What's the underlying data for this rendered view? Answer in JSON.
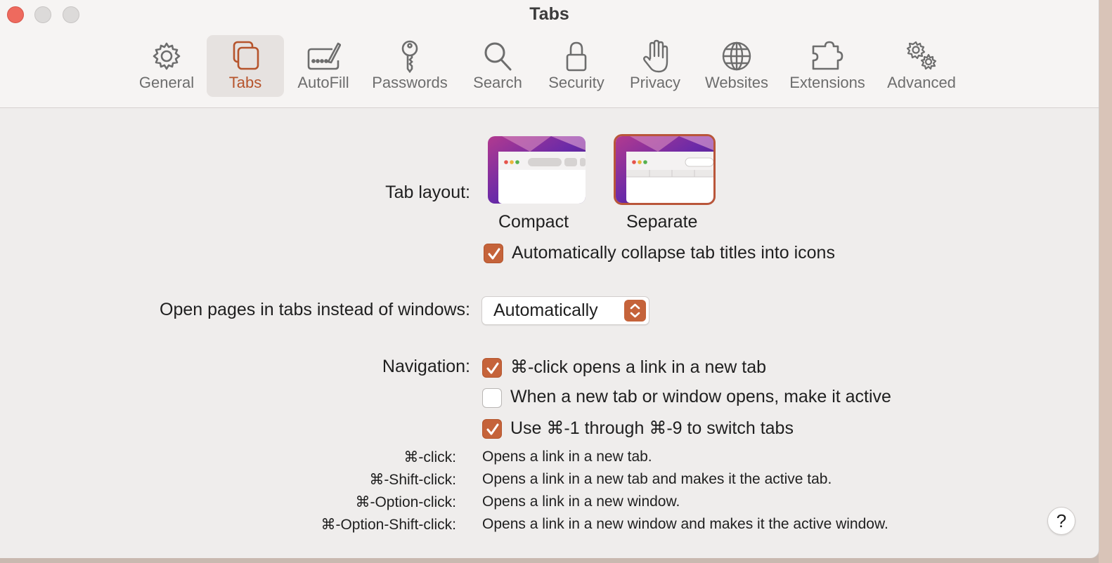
{
  "window": {
    "title": "Tabs"
  },
  "toolbar": {
    "tabs": [
      {
        "label": "General",
        "icon": "gear-icon"
      },
      {
        "label": "Tabs",
        "icon": "tabs-icon",
        "selected": true
      },
      {
        "label": "AutoFill",
        "icon": "autofill-icon"
      },
      {
        "label": "Passwords",
        "icon": "key-icon"
      },
      {
        "label": "Search",
        "icon": "magnifier-icon"
      },
      {
        "label": "Security",
        "icon": "lock-icon"
      },
      {
        "label": "Privacy",
        "icon": "hand-icon"
      },
      {
        "label": "Websites",
        "icon": "globe-icon"
      },
      {
        "label": "Extensions",
        "icon": "puzzle-icon"
      },
      {
        "label": "Advanced",
        "icon": "gears-icon"
      }
    ]
  },
  "tab_layout": {
    "label": "Tab layout:",
    "options": [
      {
        "label": "Compact",
        "selected": false
      },
      {
        "label": "Separate",
        "selected": true
      }
    ],
    "collapse_checkbox": {
      "label": "Automatically collapse tab titles into icons",
      "checked": true
    }
  },
  "open_pages": {
    "label": "Open pages in tabs instead of windows:",
    "value": "Automatically"
  },
  "navigation": {
    "label": "Navigation:",
    "checkboxes": [
      {
        "label": "⌘-click opens a link in a new tab",
        "checked": true
      },
      {
        "label": "When a new tab or window opens, make it active",
        "checked": false
      },
      {
        "label": "Use ⌘-1 through ⌘-9 to switch tabs",
        "checked": true
      }
    ]
  },
  "shortcuts": [
    {
      "key": "⌘-click:",
      "desc": "Opens a link in a new tab."
    },
    {
      "key": "⌘-Shift-click:",
      "desc": "Opens a link in a new tab and makes it the active tab."
    },
    {
      "key": "⌘-Option-click:",
      "desc": "Opens a link in a new window."
    },
    {
      "key": "⌘-Option-Shift-click:",
      "desc": "Opens a link in a new window and makes it the active window."
    }
  ],
  "help": {
    "label": "?"
  },
  "colors": {
    "accent": "#c5633a",
    "window_bg": "#efedec",
    "toolbar_bg": "#f6f4f3"
  }
}
